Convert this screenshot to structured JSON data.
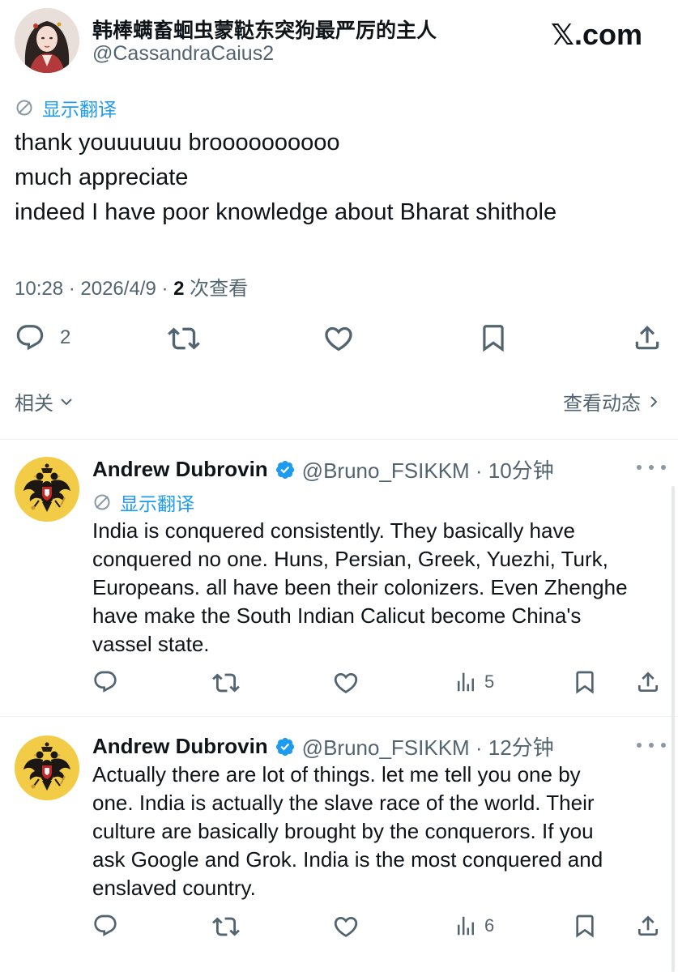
{
  "tweet": {
    "author_name": "韩棒螨畜蛔虫蒙鞑东突狗最严厉的主人",
    "author_handle": "@CassandraCaius2",
    "brand": "𝕏.com",
    "translate_label": "显示翻译",
    "lines": [
      "thank youuuuuu broooooooooo",
      "much appreciate",
      "indeed I have poor knowledge about Bharat shithole"
    ],
    "meta_time": "10:28 · 2026/4/9 · ",
    "views_count": "2",
    "views_label": " 次查看",
    "reply_count": "2"
  },
  "related_bar": {
    "left_label": "相关",
    "right_label": "查看动态"
  },
  "replies": [
    {
      "name": "Andrew Dubrovin",
      "handle_time": "@Bruno_FSIKKM · 10分钟",
      "translate_label": "显示翻译",
      "lines": [
        "India is conquered consistently. They basically have",
        "conquered no one. Huns, Persian, Greek, Yuezhi, Turk,",
        "Europeans. all have been their colonizers. Even Zhenghe",
        "have make the South Indian Calicut become China's",
        "vassel state."
      ],
      "views": "5"
    },
    {
      "name": "Andrew Dubrovin",
      "handle_time": "@Bruno_FSIKKM · 12分钟",
      "lines": [
        "Actually there are lot of things. let me tell you one by",
        "one. India is actually the slave race of the world. Their",
        "culture are basically brought by the conquerors. If you",
        "ask Google and Grok. India is the most conquered and",
        "enslaved country."
      ],
      "views": "6"
    }
  ],
  "colors": {
    "accent": "#1d9bf0",
    "text": "#0f1419",
    "secondary": "#536471",
    "avatar_gold": "#f2cc47"
  },
  "icons": [
    "avatar",
    "translate-icon",
    "reply-icon",
    "retweet-icon",
    "like-icon",
    "bookmark-icon",
    "share-icon",
    "views-icon",
    "verified-badge-icon",
    "more-icon",
    "chevron-down-icon",
    "chevron-right-icon"
  ]
}
